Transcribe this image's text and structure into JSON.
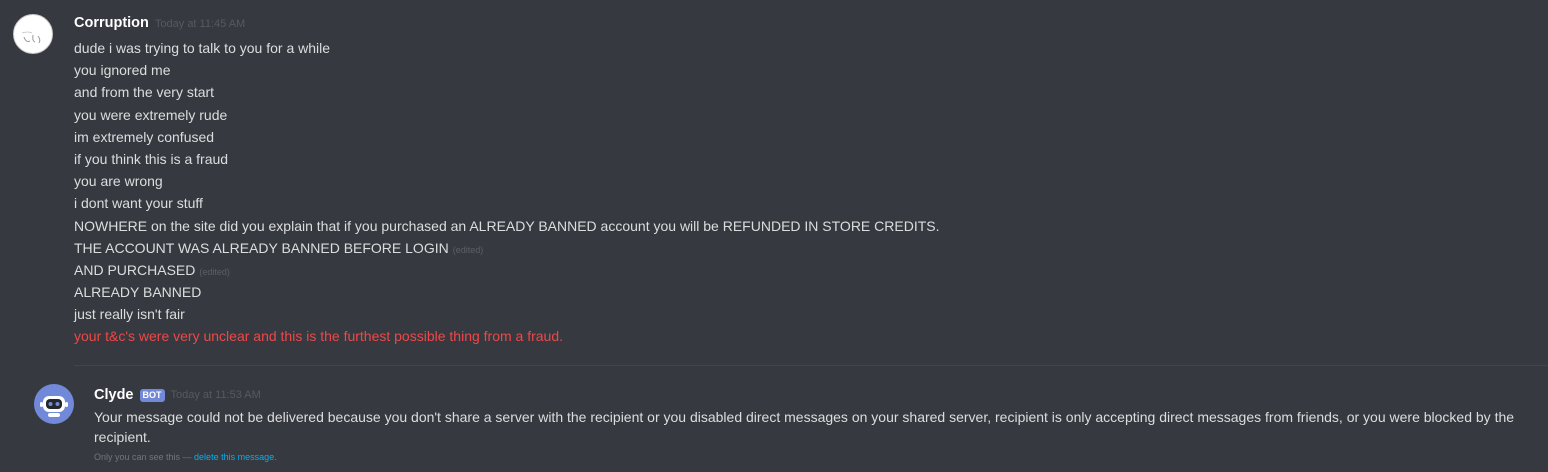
{
  "messages": [
    {
      "author": "Corruption",
      "timestamp": "Today at 11:45 AM",
      "lines": [
        {
          "text": "dude i was trying to talk to you for a while",
          "edited": ""
        },
        {
          "text": "you ignored me",
          "edited": ""
        },
        {
          "text": "and from the very start",
          "edited": ""
        },
        {
          "text": "you were extremely rude",
          "edited": ""
        },
        {
          "text": "im extremely confused",
          "edited": ""
        },
        {
          "text": "if you think this is a fraud",
          "edited": ""
        },
        {
          "text": "you are wrong",
          "edited": ""
        },
        {
          "text": "i dont want your stuff",
          "edited": ""
        },
        {
          "text": "NOWHERE on  the site did you explain that if you purchased an ALREADY BANNED account you will be REFUNDED IN STORE CREDITS.",
          "edited": ""
        },
        {
          "text": "THE ACCOUNT WAS ALREADY BANNED BEFORE LOGIN",
          "edited": "(edited)"
        },
        {
          "text": "AND PURCHASED",
          "edited": "(edited)"
        },
        {
          "text": "ALREADY BANNED",
          "edited": ""
        },
        {
          "text": "just really isn't fair",
          "edited": ""
        },
        {
          "text": "your t&c's were very unclear and this is the furthest possible thing from a fraud.",
          "edited": "",
          "color": "#f04747"
        }
      ]
    },
    {
      "author": "Clyde",
      "bot_tag": "BOT",
      "timestamp": "Today at 11:53 AM",
      "text": "Your message could not be delivered because you don't share a server with the recipient or you disabled direct messages on your shared server, recipient is only accepting direct messages from friends, or you were blocked by the recipient.",
      "ephemeral_note": "Only you can see this — ",
      "ephemeral_link": "delete this message."
    }
  ],
  "icons": {
    "avatar_1": "sketch-face-avatar-icon",
    "avatar_2": "clyde-robot-avatar-icon"
  },
  "colors": {
    "background": "#36393f",
    "text": "#dcddde",
    "error_text": "#f04747",
    "bot_tag": "#7289da",
    "link": "#00b0f4"
  }
}
